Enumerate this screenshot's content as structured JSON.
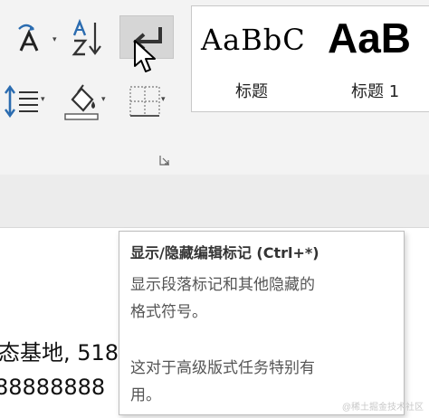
{
  "ribbon": {
    "styles": [
      {
        "sample": "AaBbC",
        "name": "标题"
      },
      {
        "sample": "AaB",
        "name": "标题 1"
      }
    ]
  },
  "document": {
    "lines": [
      "态基地, 518",
      "88888888"
    ]
  },
  "tooltip": {
    "title": "显示/隐藏编辑标记 (Ctrl+*)",
    "description_lines": [
      "显示段落标记和其他隐藏的",
      "格式符号。"
    ],
    "note_lines": [
      "这对于高级版式任务特别有",
      "用。"
    ]
  },
  "watermark": "@稀土掘金技术社区"
}
